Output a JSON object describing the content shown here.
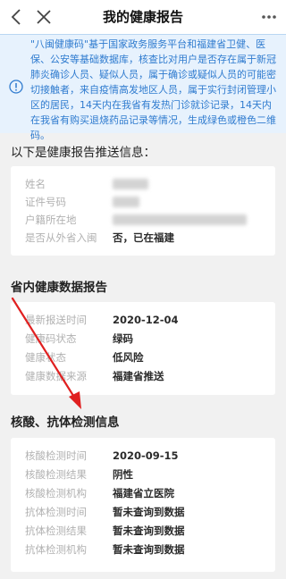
{
  "header": {
    "title": "我的健康报告",
    "back_icon": "chevron-left-icon",
    "close_icon": "close-icon",
    "more_icon": "more-dots-icon"
  },
  "notice": {
    "text": "\"八闽健康码\"基于国家政务服务平台和福建省卫健、医保、公安等基础数据库，核查比对用户是否存在属于新冠肺炎确诊人员、疑似人员，属于确诊或疑似人员的可能密切接触者，来自疫情高发地区人员，属于实行封闭管理小区的居民，14天内在我省有发热门诊就诊记录，14天内在我省有购买退烧药品记录等情况，生成绿色或橙色二维码。",
    "icon": "info-circle-icon",
    "color": "#2f7bcf"
  },
  "sections": {
    "push_info": {
      "heading": "以下是健康报告推送信息：",
      "rows": [
        {
          "label": "姓名",
          "value": ""
        },
        {
          "label": "证件号码",
          "value": ""
        },
        {
          "label": "户籍所在地",
          "value": ""
        },
        {
          "label": "是否从外省入闽",
          "value": "否，已在福建"
        }
      ]
    },
    "province": {
      "heading": "省内健康数据报告",
      "rows": [
        {
          "label": "最新报送时间",
          "value": "2020-12-04"
        },
        {
          "label": "健康码状态",
          "value": "绿码"
        },
        {
          "label": "健康状态",
          "value": "低风险"
        },
        {
          "label": "健康数据来源",
          "value": "福建省推送"
        }
      ]
    },
    "test": {
      "heading": "核酸、抗体检测信息",
      "rows": [
        {
          "label": "核酸检测时间",
          "value": "2020-09-15"
        },
        {
          "label": "核酸检测结果",
          "value": "阴性"
        },
        {
          "label": "核酸检测机构",
          "value": "福建省立医院"
        },
        {
          "label": "抗体检测时间",
          "value": "暂未查询到数据"
        },
        {
          "label": "抗体检测结果",
          "value": "暂未查询到数据"
        },
        {
          "label": "抗体检测机构",
          "value": "暂未查询到数据"
        }
      ]
    }
  },
  "colors": {
    "annotation_arrow": "#e02020",
    "page_background": "#f1f1f1",
    "notice_background": "#e7f2fd"
  }
}
